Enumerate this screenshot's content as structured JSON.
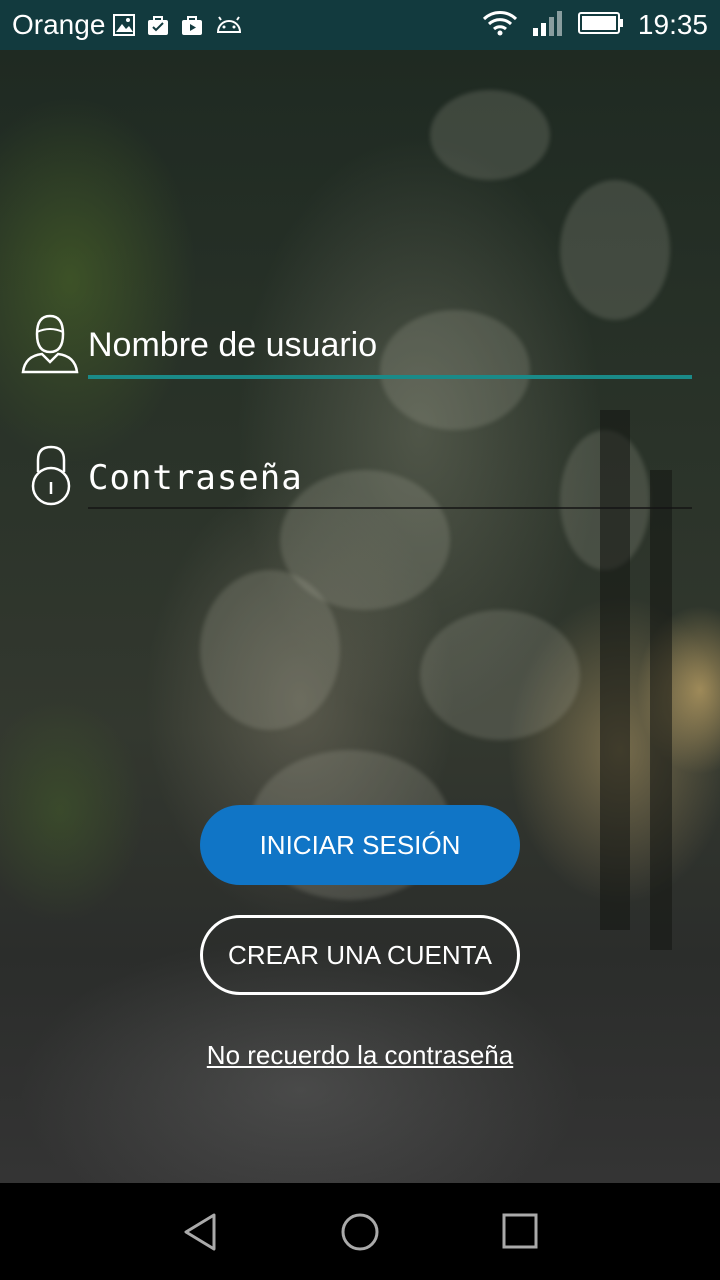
{
  "status_bar": {
    "carrier": "Orange",
    "time": "19:35",
    "left_icons": [
      "image-icon",
      "shopping-bag-icon",
      "media-store-icon",
      "android-icon"
    ],
    "right_icons": [
      "wifi-icon",
      "signal-icon",
      "battery-icon"
    ]
  },
  "login": {
    "username_label": "Nombre de usuario",
    "password_label": "Contraseña",
    "login_button": "INICIAR SESIÓN",
    "create_button": "CREAR UNA CUENTA",
    "forgot_link": "No recuerdo la contraseña"
  },
  "colors": {
    "status_bar": "#123a3e",
    "accent_underline": "#1a8a88",
    "primary_button": "#1075c6"
  },
  "nav_bar": {
    "icons": [
      "back-icon",
      "home-icon",
      "recents-icon"
    ]
  }
}
